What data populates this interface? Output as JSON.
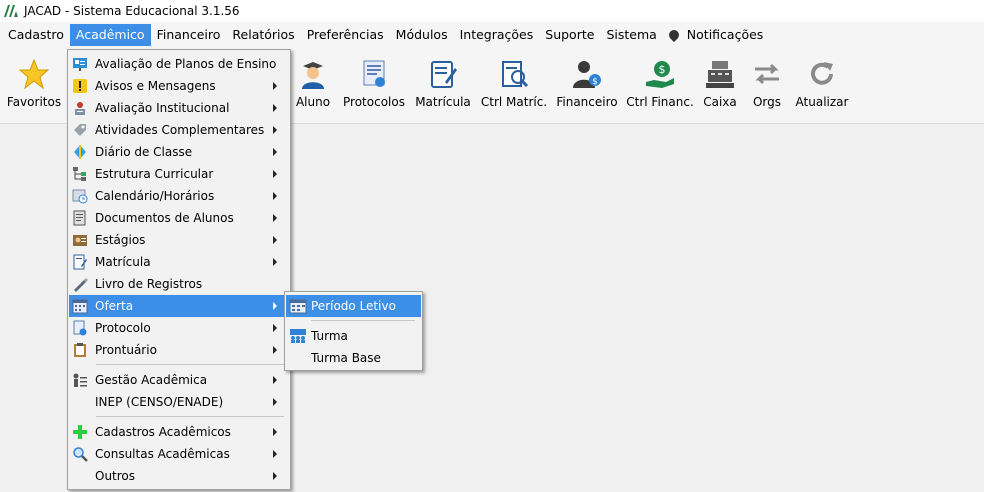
{
  "window": {
    "title": "JACAD - Sistema Educacional 3.1.56"
  },
  "menubar": [
    {
      "label": "Cadastro"
    },
    {
      "label": "Acadêmico"
    },
    {
      "label": "Financeiro"
    },
    {
      "label": "Relatórios"
    },
    {
      "label": "Preferências"
    },
    {
      "label": "Módulos"
    },
    {
      "label": "Integrações"
    },
    {
      "label": "Suporte"
    },
    {
      "label": "Sistema"
    },
    {
      "label": "Notificações"
    }
  ],
  "toolbar": [
    {
      "label": "Favoritos"
    },
    {
      "label": "Aluno"
    },
    {
      "label": "Protocolos"
    },
    {
      "label": "Matrícula"
    },
    {
      "label": "Ctrl Matríc."
    },
    {
      "label": "Financeiro"
    },
    {
      "label": "Ctrl Financ."
    },
    {
      "label": "Caixa"
    },
    {
      "label": "Orgs"
    },
    {
      "label": "Atualizar"
    }
  ],
  "academico_menu": [
    {
      "label": "Avaliação de Planos de Ensino"
    },
    {
      "label": "Avisos e Mensagens"
    },
    {
      "label": "Avaliação Institucional"
    },
    {
      "label": "Atividades Complementares"
    },
    {
      "label": "Diário de Classe"
    },
    {
      "label": "Estrutura Curricular"
    },
    {
      "label": "Calendário/Horários"
    },
    {
      "label": "Documentos de Alunos"
    },
    {
      "label": "Estágios"
    },
    {
      "label": "Matrícula"
    },
    {
      "label": "Livro de Registros"
    },
    {
      "label": "Oferta"
    },
    {
      "label": "Protocolo"
    },
    {
      "label": "Prontuário"
    },
    {
      "label": "Gestão Acadêmica"
    },
    {
      "label": "INEP (CENSO/ENADE)"
    },
    {
      "label": "Cadastros Acadêmicos"
    },
    {
      "label": "Consultas Acadêmicas"
    },
    {
      "label": "Outros"
    }
  ],
  "oferta_submenu": [
    {
      "label": "Período Letivo"
    },
    {
      "label": "Turma"
    },
    {
      "label": "Turma Base"
    }
  ]
}
